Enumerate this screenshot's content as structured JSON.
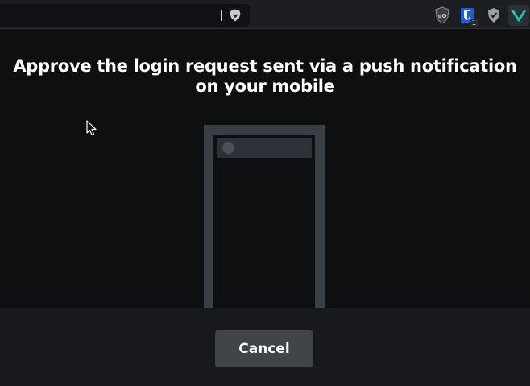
{
  "toolbar": {
    "extensions": [
      {
        "icon": "ublock-origin-icon",
        "label": "uO"
      },
      {
        "icon": "bitwarden-icon",
        "badge": "1"
      },
      {
        "icon": "shield-check-icon"
      },
      {
        "icon": "vivaldi-like-icon"
      }
    ]
  },
  "dialog": {
    "title": "Approve the login request sent via a push notification on your mobile",
    "cancel_label": "Cancel"
  },
  "colors": {
    "background": "#0e0f11",
    "toolbar": "#1c1e22",
    "footer": "#17191c",
    "phone_frame": "#3a3f46",
    "button": "#414448",
    "accent_teal": "#20c4b0"
  }
}
